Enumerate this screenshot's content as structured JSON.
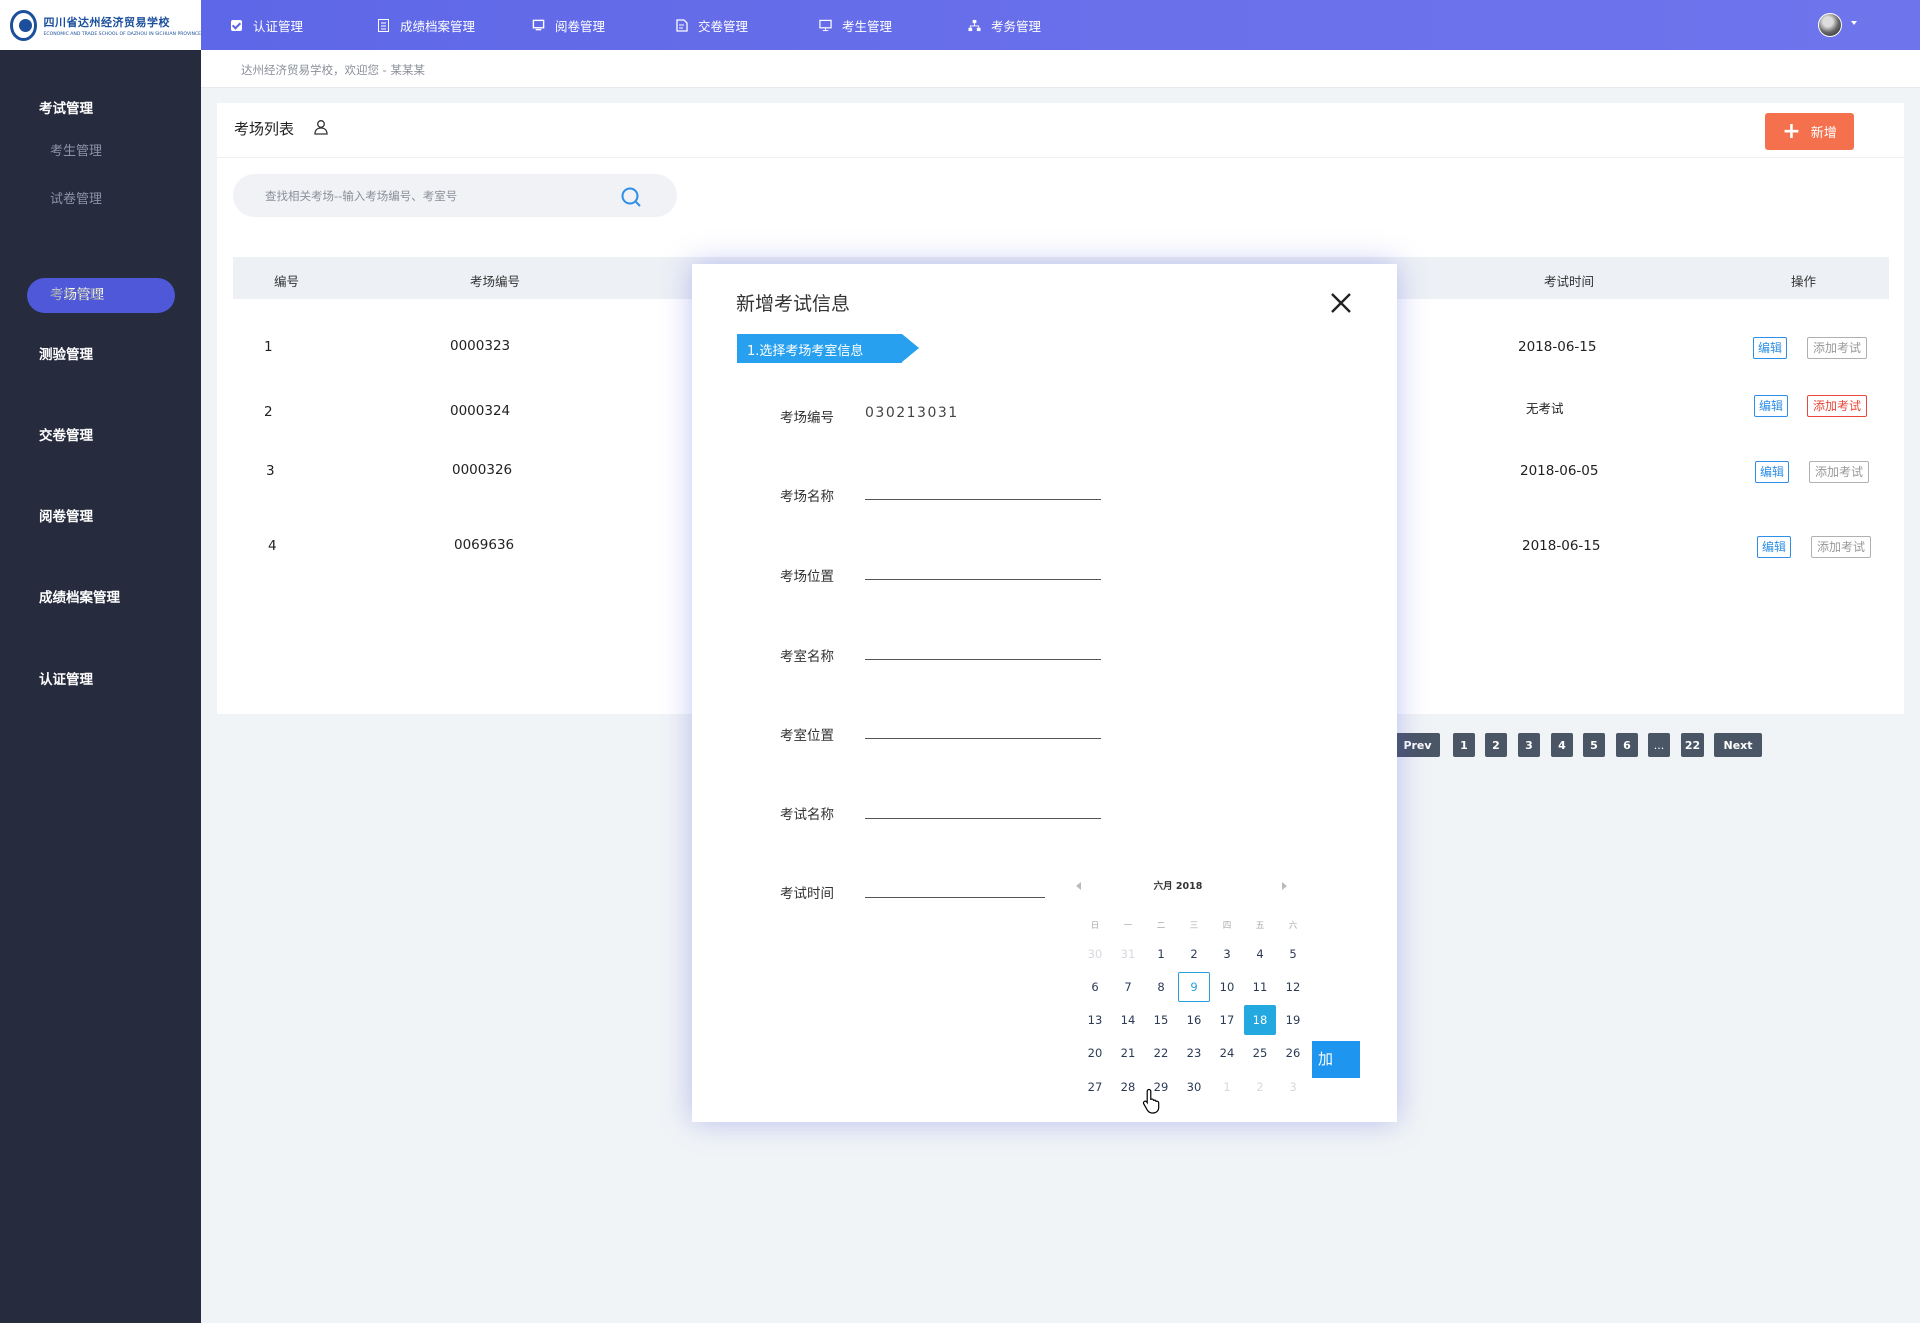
{
  "logo": {
    "name_cn": "四川省达州经济贸易学校",
    "name_en": "ECONOMIC AND TRADE SCHOOL OF DAZHOU IN SICHUAN PROVINCE"
  },
  "topnav": [
    {
      "label": "认证管理",
      "icon": "checkbox-icon"
    },
    {
      "label": "成绩档案管理",
      "icon": "document-icon"
    },
    {
      "label": "阅卷管理",
      "icon": "monitor-icon"
    },
    {
      "label": "交卷管理",
      "icon": "file-edit-icon"
    },
    {
      "label": "考生管理",
      "icon": "desktop-icon"
    },
    {
      "label": "考务管理",
      "icon": "org-chart-icon"
    }
  ],
  "sidebar": {
    "groups": [
      {
        "label": "考试管理"
      },
      {
        "label": "测验管理"
      },
      {
        "label": "交卷管理"
      },
      {
        "label": "阅卷管理"
      },
      {
        "label": "成绩档案管理"
      },
      {
        "label": "认证管理"
      }
    ],
    "subitems": [
      {
        "label": "考生管理"
      },
      {
        "label": "试卷管理"
      },
      {
        "label": "考场管理"
      },
      {
        "label": "考务管理"
      }
    ]
  },
  "breadcrumb": "达州经济贸易学校，欢迎您 - 某某某",
  "list": {
    "title": "考场列表",
    "add_label": "新增",
    "search_placeholder": "查找相关考场--输入考场编号、考室号",
    "headers": {
      "no": "编号",
      "code": "考场编号",
      "time": "考试时间",
      "ops": "操作"
    },
    "rows": [
      {
        "no": "1",
        "code": "0000323",
        "time": "2018-06-15",
        "edit": "编辑",
        "add": "添加考试"
      },
      {
        "no": "2",
        "code": "0000324",
        "time": "无考试",
        "edit": "编辑",
        "add": "添加考试"
      },
      {
        "no": "3",
        "code": "0000326",
        "time": "2018-06-05",
        "edit": "编辑",
        "add": "添加考试"
      },
      {
        "no": "4",
        "code": "0069636",
        "time": "2018-06-15",
        "edit": "编辑",
        "add": "添加考试"
      }
    ],
    "pagination": [
      "Prev",
      "1",
      "2",
      "3",
      "4",
      "5",
      "6",
      "...",
      "22",
      "Next"
    ]
  },
  "modal": {
    "title": "新增考试信息",
    "step": "1.选择考场考室信息",
    "fields": [
      {
        "label": "考场编号",
        "value": "030213031"
      },
      {
        "label": "考场名称",
        "value": ""
      },
      {
        "label": "考场位置",
        "value": ""
      },
      {
        "label": "考室名称",
        "value": ""
      },
      {
        "label": "考室位置",
        "value": ""
      },
      {
        "label": "考试名称",
        "value": ""
      },
      {
        "label": "考试时间",
        "value": ""
      }
    ],
    "submit_partial": "加"
  },
  "calendar": {
    "month_label": "六月 2018",
    "weekdays": [
      "日",
      "一",
      "二",
      "三",
      "四",
      "五",
      "六"
    ],
    "days": [
      [
        "30",
        "31",
        "1",
        "2",
        "3",
        "4",
        "5"
      ],
      [
        "6",
        "7",
        "8",
        "9",
        "10",
        "11",
        "12"
      ],
      [
        "13",
        "14",
        "15",
        "16",
        "17",
        "18",
        "19"
      ],
      [
        "20",
        "21",
        "22",
        "23",
        "24",
        "25",
        "26"
      ],
      [
        "27",
        "28",
        "29",
        "30",
        "1",
        "2",
        "3"
      ]
    ],
    "today": "9",
    "selected": "18"
  },
  "colors": {
    "topbar": "#5b65e6",
    "sidebar": "#262b3d",
    "accent_orange": "#f5714e",
    "accent_blue": "#28a0f0"
  }
}
